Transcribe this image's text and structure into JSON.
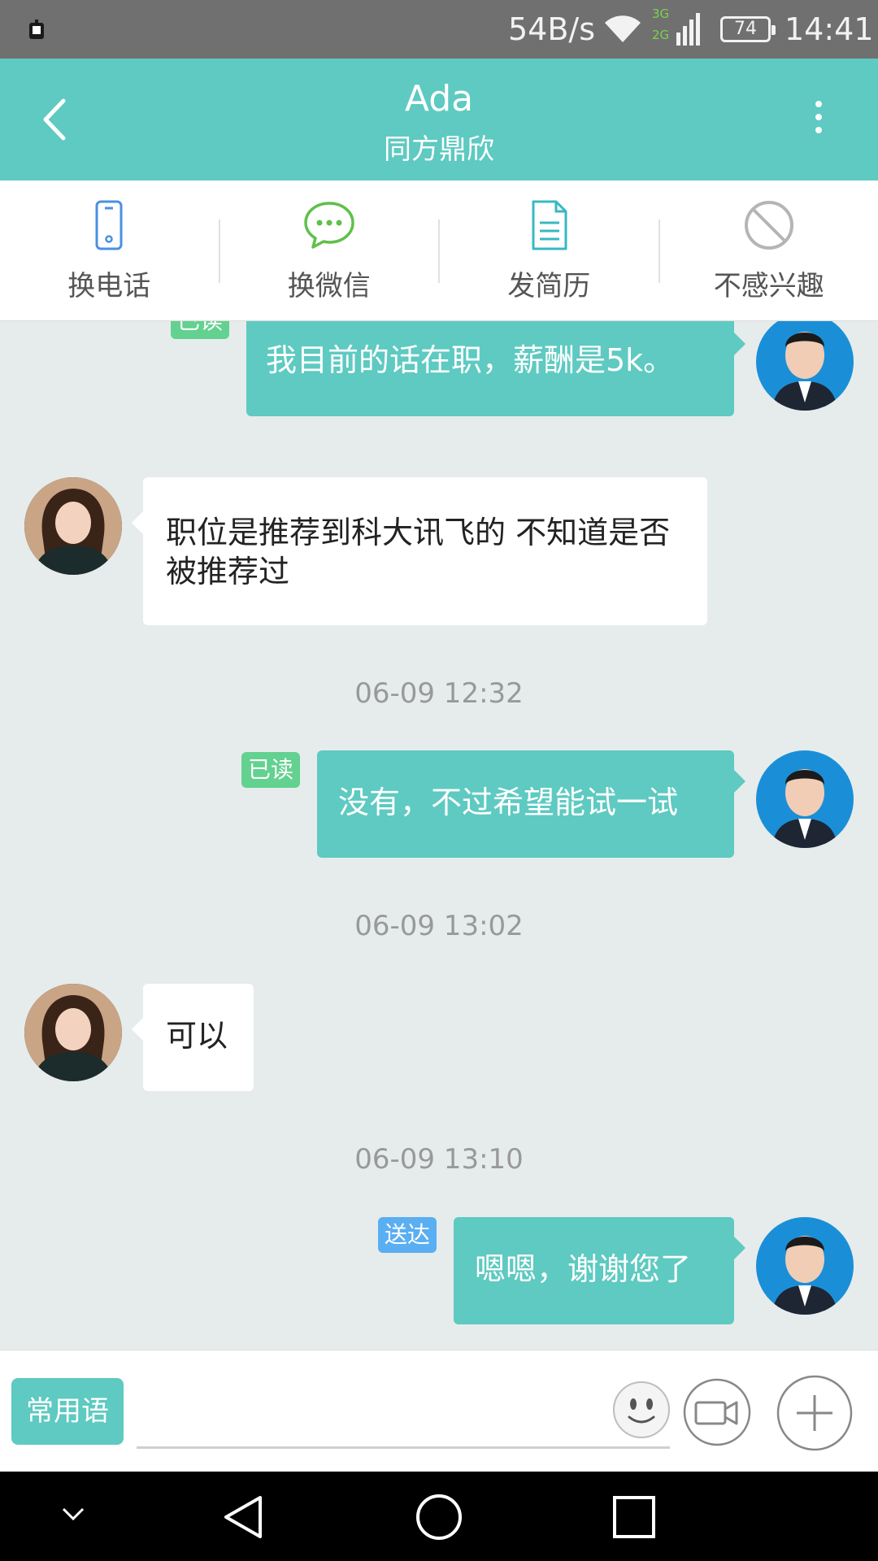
{
  "status_bar": {
    "speed": "54B/s",
    "network_3g": "3G",
    "network_2g": "2G",
    "battery": "74",
    "time": "14:41"
  },
  "header": {
    "title": "Ada",
    "subtitle": "同方鼎欣"
  },
  "actions": [
    {
      "label": "换电话",
      "icon": "phone-icon"
    },
    {
      "label": "换微信",
      "icon": "wechat-icon"
    },
    {
      "label": "发简历",
      "icon": "resume-icon"
    },
    {
      "label": "不感兴趣",
      "icon": "block-icon"
    }
  ],
  "messages": [
    {
      "from": "me",
      "text": "我目前的话在职，薪酬是5k。",
      "status": "已读"
    },
    {
      "from": "ada",
      "text": "职位是推荐到科大讯飞的 不知道是否被推荐过"
    },
    {
      "timestamp": "06-09 12:32"
    },
    {
      "from": "me",
      "text": "没有，不过希望能试一试",
      "status": "已读"
    },
    {
      "timestamp": "06-09 13:02"
    },
    {
      "from": "ada",
      "text": "可以"
    },
    {
      "timestamp": "06-09 13:10"
    },
    {
      "from": "me",
      "text": "嗯嗯，谢谢您了",
      "status": "送达"
    }
  ],
  "input_bar": {
    "quick_phrases_label": "常用语"
  },
  "colors": {
    "accent": "#5ecac1",
    "read_tag": "#63d190",
    "sent_tag": "#5aaef2",
    "chat_bg": "#e6ecec"
  }
}
